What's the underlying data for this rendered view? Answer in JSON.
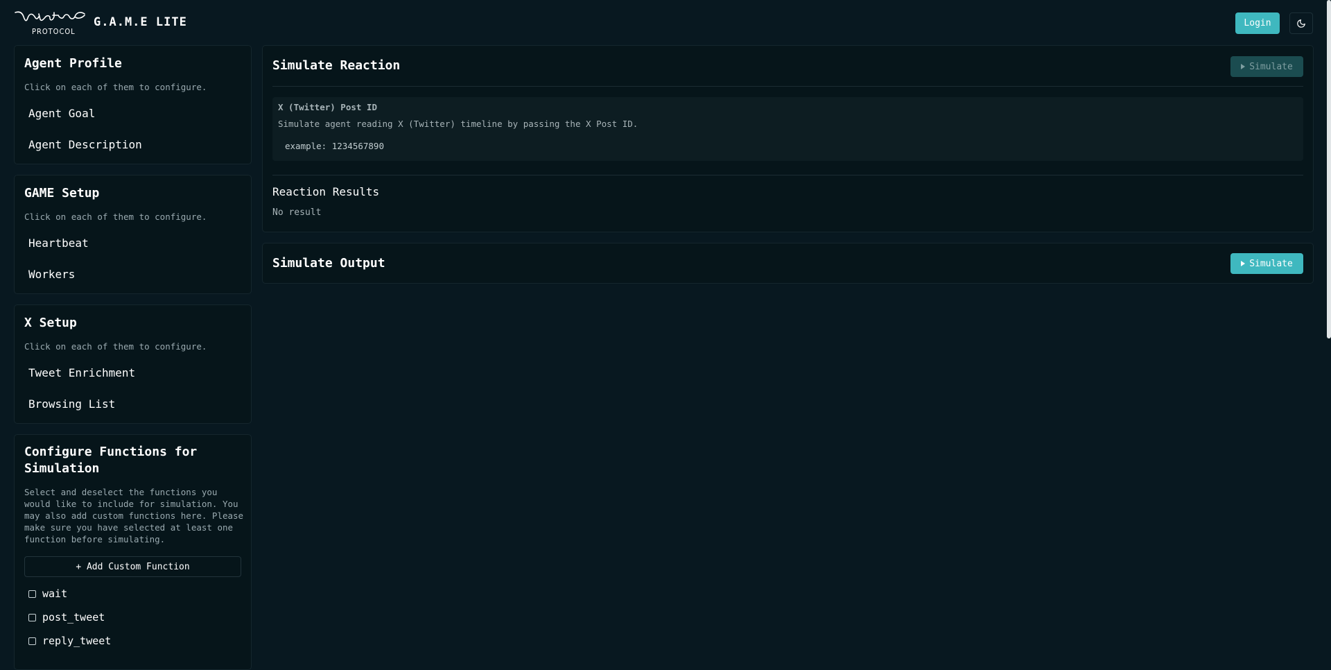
{
  "header": {
    "logo_script": "Virtual",
    "logo_sub": "PROTOCOL",
    "app_title": "G.A.M.E LITE",
    "login_label": "Login",
    "theme_icon": "moon-icon"
  },
  "sidebar": {
    "agent_profile": {
      "title": "Agent Profile",
      "description": "Click on each of them to configure.",
      "items": [
        "Agent Goal",
        "Agent Description"
      ]
    },
    "game_setup": {
      "title": "GAME Setup",
      "description": "Click on each of them to configure.",
      "items": [
        "Heartbeat",
        "Workers"
      ]
    },
    "x_setup": {
      "title": "X Setup",
      "description": "Click on each of them to configure.",
      "items": [
        "Tweet Enrichment",
        "Browsing List"
      ]
    },
    "functions": {
      "title": "Configure Functions for Simulation",
      "description": "Select and deselect the functions you would like to include for simulation. You may also add custom functions here. Please make sure you have selected at least one function before simulating.",
      "add_label": "+ Add Custom Function",
      "options": [
        {
          "label": "wait",
          "checked": false
        },
        {
          "label": "post_tweet",
          "checked": false
        },
        {
          "label": "reply_tweet",
          "checked": false
        }
      ]
    }
  },
  "reaction": {
    "title": "Simulate Reaction",
    "simulate_label": "Simulate",
    "input_label": "X (Twitter) Post ID",
    "input_description": "Simulate agent reading X (Twitter) timeline by passing the X Post ID.",
    "input_placeholder": "example: 1234567890",
    "results_title": "Reaction Results",
    "results_value": "No result"
  },
  "output": {
    "title": "Simulate Output",
    "simulate_label": "Simulate"
  },
  "colors": {
    "background": "#081820",
    "card": "#06151a",
    "accent": "#3fb8bf",
    "accent_disabled": "#1b4c50"
  }
}
